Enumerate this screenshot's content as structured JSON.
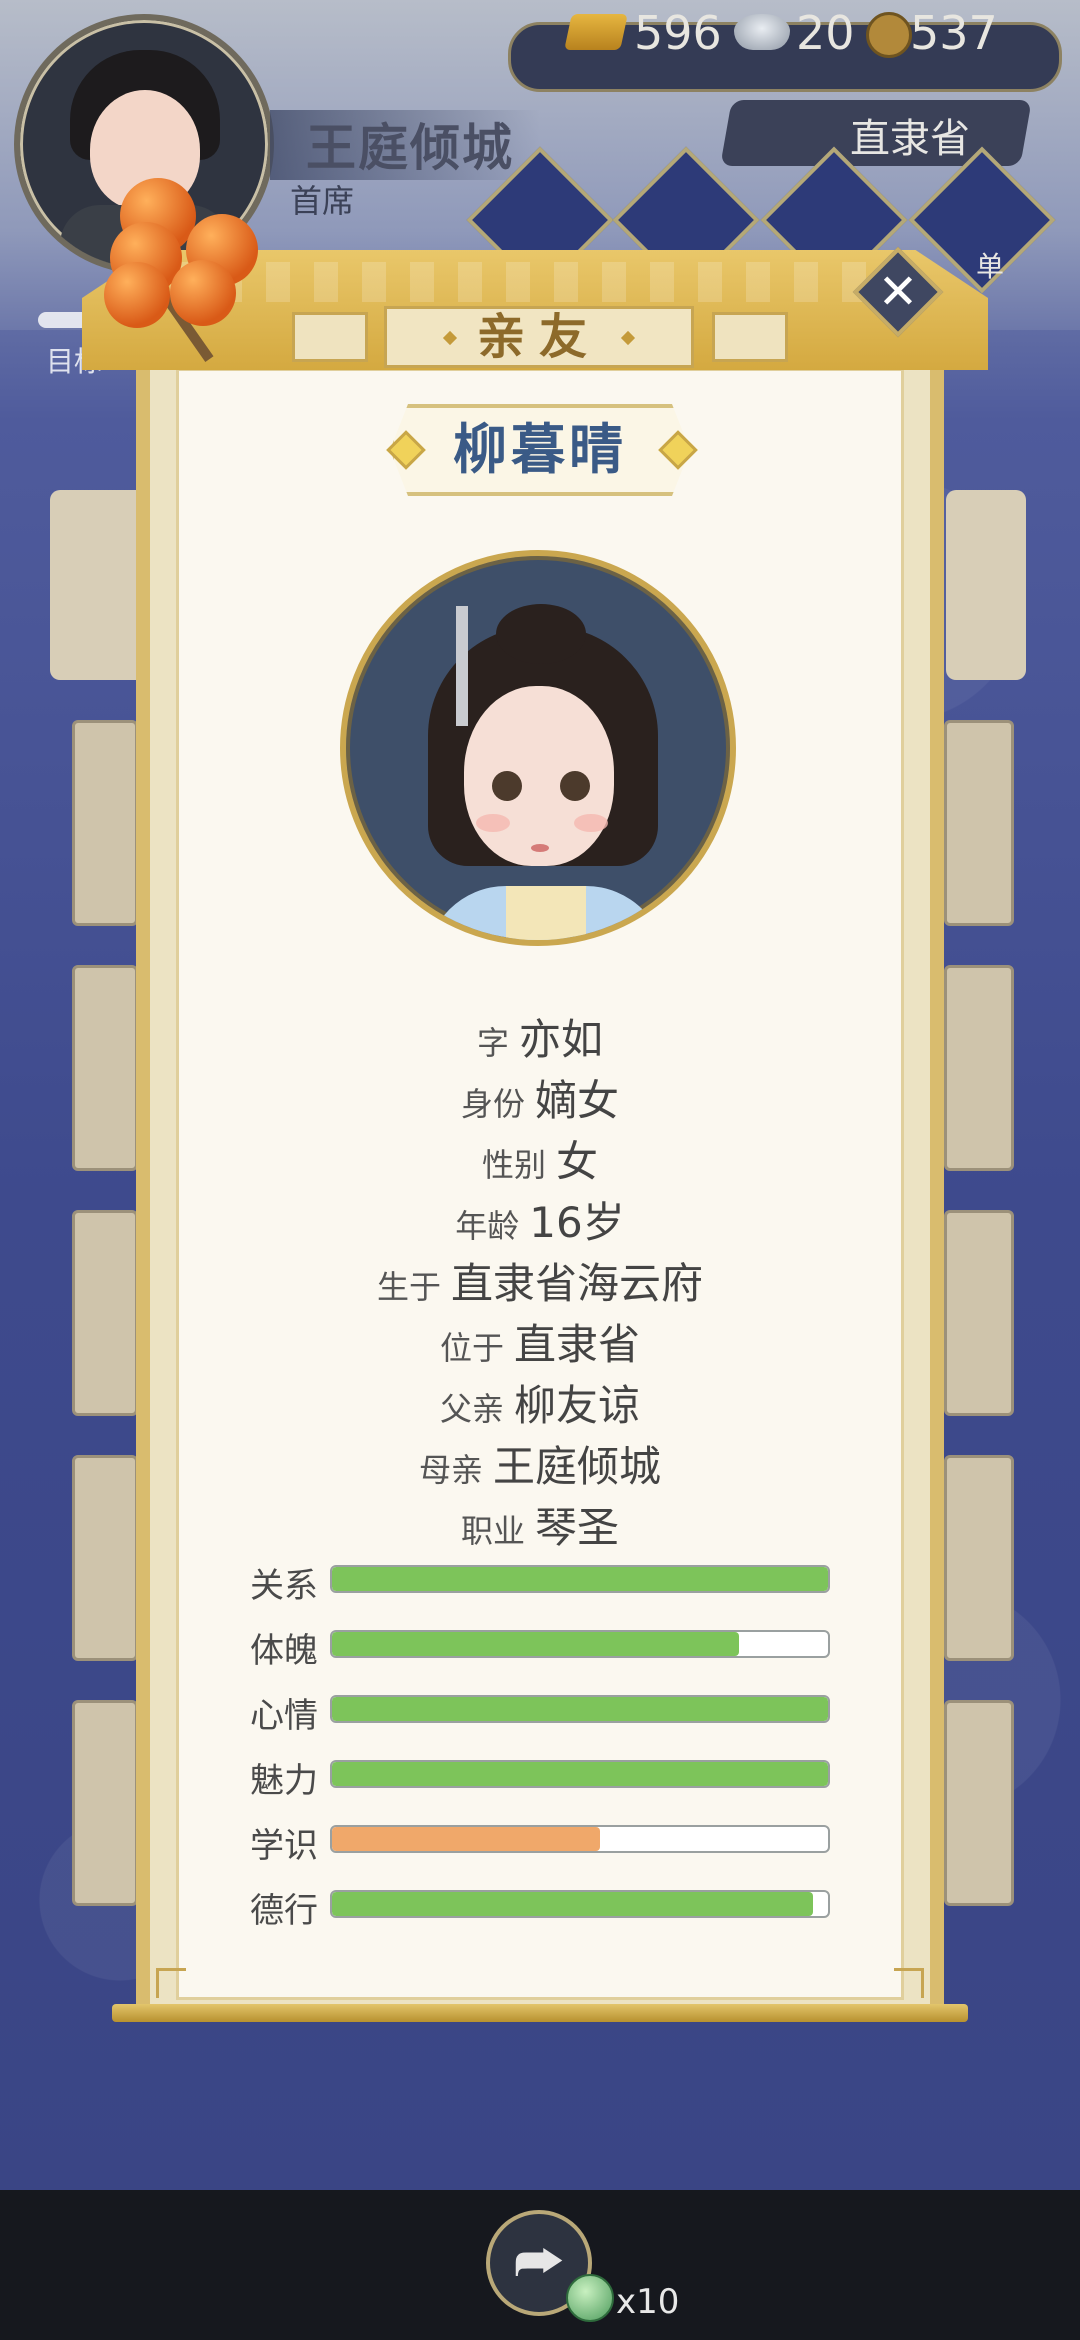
{
  "player": {
    "name": "王庭倾城",
    "rank": "首席"
  },
  "currency": {
    "gold": "596",
    "silver": "20",
    "coins": "537"
  },
  "region": "直隶省",
  "top_menu": {
    "partial_label": "单"
  },
  "goal": {
    "label": "目标"
  },
  "panel": {
    "title": "亲友",
    "close_icon": "close-icon"
  },
  "character": {
    "name": "柳暮晴",
    "info": [
      {
        "key": "字",
        "value": "亦如"
      },
      {
        "key": "身份",
        "value": "嫡女"
      },
      {
        "key": "性别",
        "value": "女"
      },
      {
        "key": "年龄",
        "value": "16岁"
      },
      {
        "key": "生于",
        "value": "直隶省海云府"
      },
      {
        "key": "位于",
        "value": "直隶省"
      },
      {
        "key": "父亲",
        "value": "柳友谅"
      },
      {
        "key": "母亲",
        "value": "王庭倾城"
      },
      {
        "key": "职业",
        "value": "琴圣"
      }
    ],
    "stats": [
      {
        "label": "关系",
        "level": 1.0,
        "color": "#7dc45a"
      },
      {
        "label": "体魄",
        "level": 0.82,
        "color": "#7dc45a"
      },
      {
        "label": "心情",
        "level": 1.0,
        "color": "#7dc45a"
      },
      {
        "label": "魅力",
        "level": 1.0,
        "color": "#7dc45a"
      },
      {
        "label": "学识",
        "level": 0.54,
        "color": "#f0a86a"
      },
      {
        "label": "德行",
        "level": 0.97,
        "color": "#7dc45a"
      }
    ]
  },
  "bottom": {
    "share_icon": "share-icon",
    "reward_count": "x10"
  }
}
